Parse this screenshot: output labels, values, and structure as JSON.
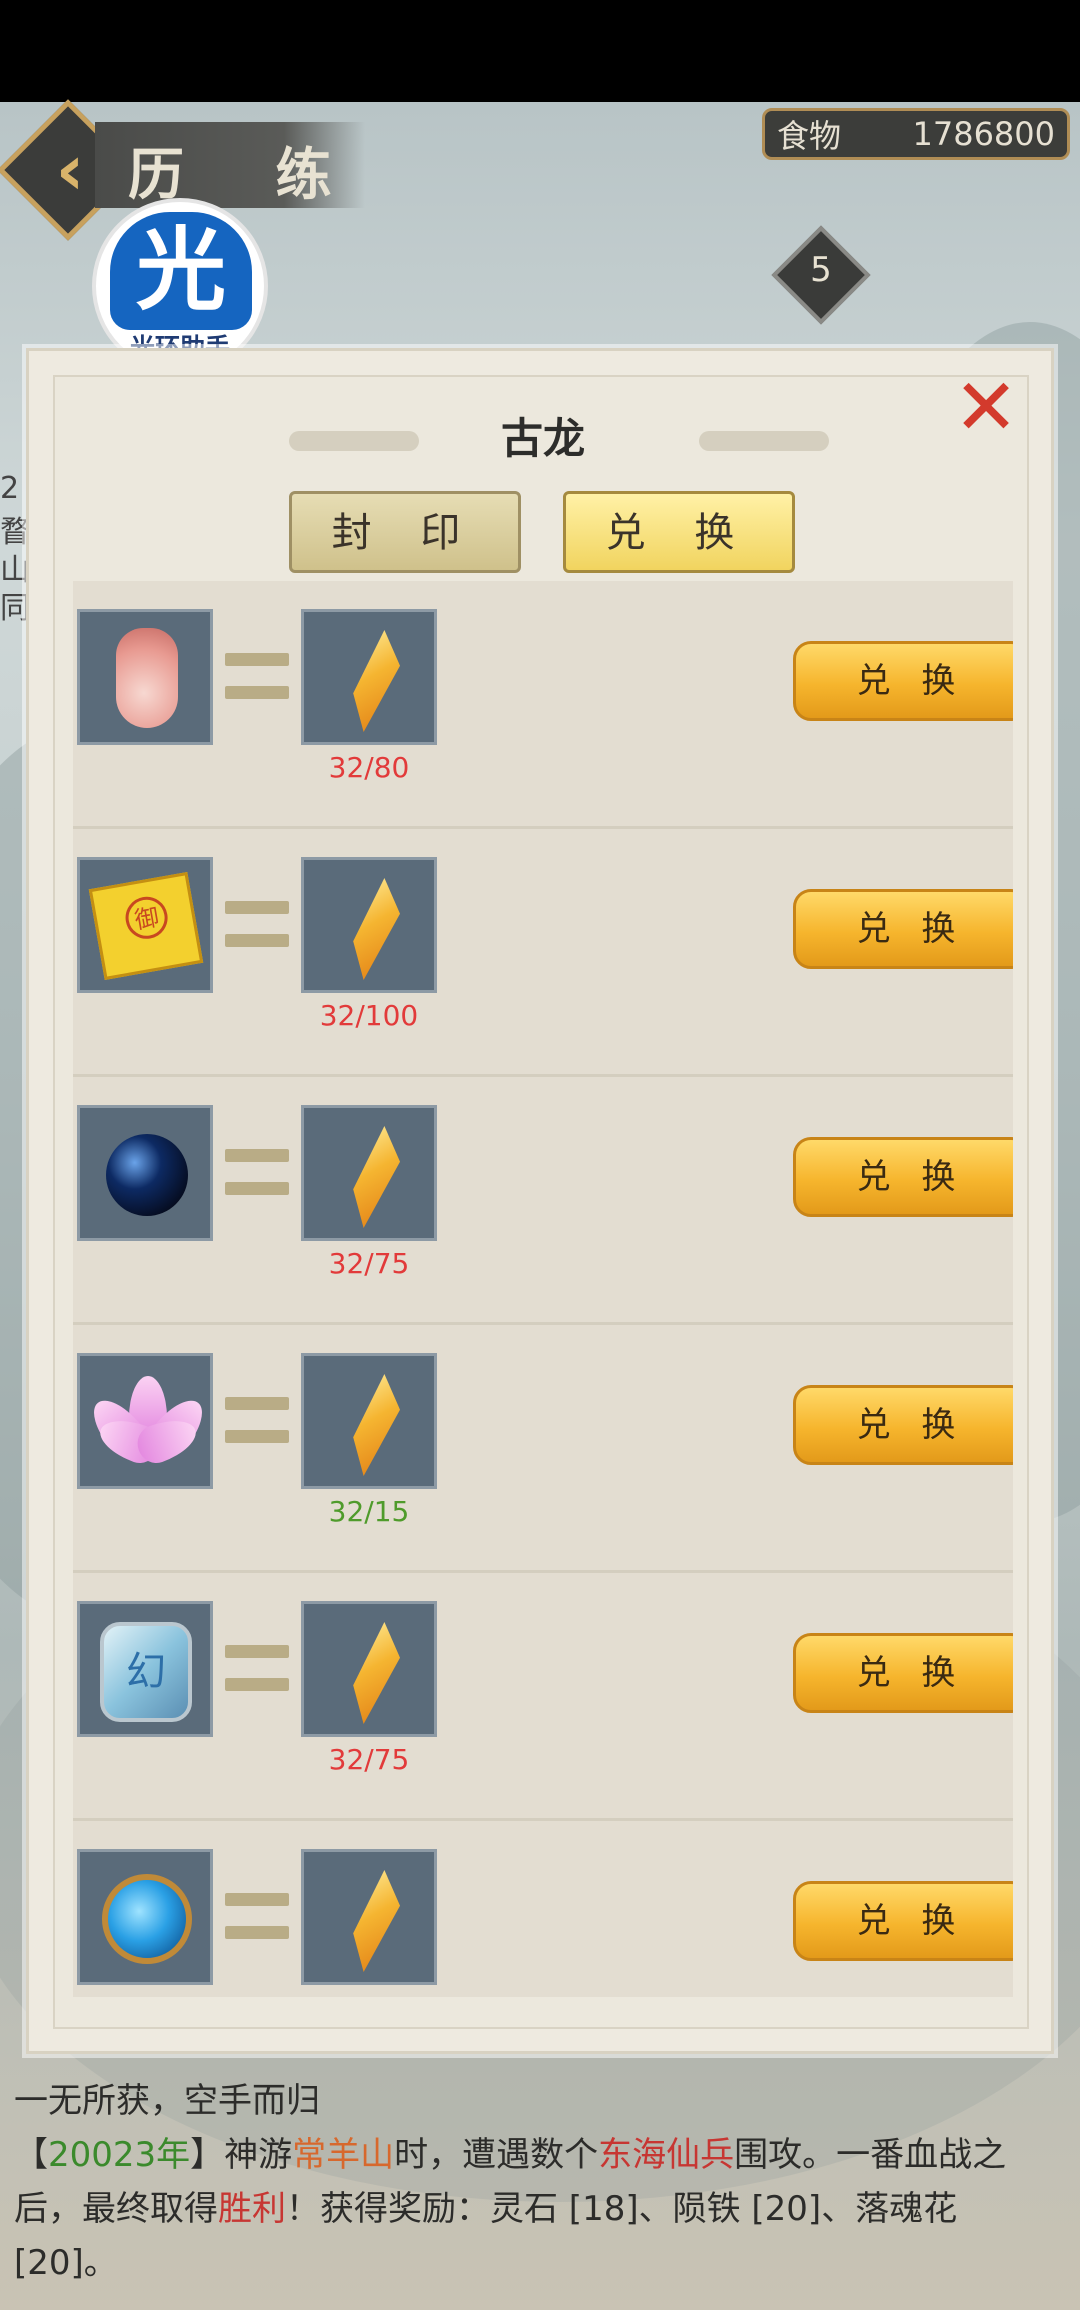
{
  "header": {
    "back_icon": "chevron-left-icon",
    "title": "历 练",
    "food_label": "食物",
    "food_value": "1786800",
    "level_badge": "5",
    "side_number": "2",
    "side_text": "瞀山同"
  },
  "logo": {
    "glyph": "光",
    "text": "光环助手"
  },
  "dialog": {
    "title": "古龙",
    "close_icon": "close-x-icon",
    "tabs": [
      {
        "label": "封 印",
        "active": false
      },
      {
        "label": "兑 换",
        "active": true
      }
    ],
    "rows": [
      {
        "item_icon": "porcelain-vase-icon",
        "reward_icon": "golden-shard-icon",
        "ratio": "32/80",
        "ratio_color": "#e23a3a",
        "button": "兑 换"
      },
      {
        "item_icon": "imperial-scroll-icon",
        "reward_icon": "golden-shard-icon",
        "ratio": "32/100",
        "ratio_color": "#e23a3a",
        "button": "兑 换"
      },
      {
        "item_icon": "dark-orb-icon",
        "reward_icon": "golden-shard-icon",
        "ratio": "32/75",
        "ratio_color": "#e23a3a",
        "button": "兑 换"
      },
      {
        "item_icon": "lotus-flower-icon",
        "reward_icon": "golden-shard-icon",
        "ratio": "32/15",
        "ratio_color": "#4f9b2b",
        "button": "兑 换"
      },
      {
        "item_icon": "jade-token-icon",
        "reward_icon": "golden-shard-icon",
        "ratio": "32/75",
        "ratio_color": "#e23a3a",
        "button": "兑 换"
      },
      {
        "item_icon": "blue-spirit-orb-icon",
        "reward_icon": "golden-shard-icon",
        "ratio": "",
        "ratio_color": "#e23a3a",
        "button": "兑 换"
      }
    ]
  },
  "log": {
    "line1": "一无所获，空手而归",
    "p_open": "【",
    "year": "20023年",
    "p_close": "】神游",
    "place": "常羊山",
    "mid": "时，遭遇数个",
    "enemy": "东海仙兵",
    "after_enemy": "围攻。一番血战之后，最终取得",
    "result": "胜利",
    "rewards": "！获得奖励：灵石 [18]、陨铁 [20]、落魂花 [20]。"
  },
  "colors": {
    "accent_gold": "#f6b52d",
    "ratio_red": "#e23a3a",
    "ratio_green": "#4f9b2b",
    "close_red": "#d33a2c"
  }
}
